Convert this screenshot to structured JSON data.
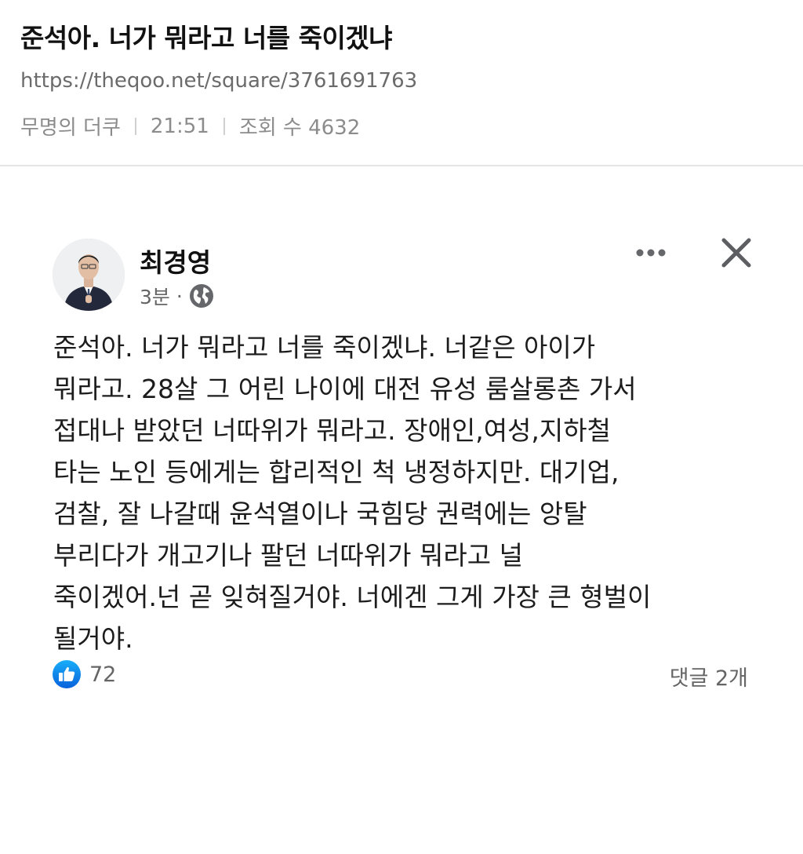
{
  "header": {
    "title": "준석아. 너가 뭐라고 너를 죽이겠냐",
    "url": "https://theqoo.net/square/3761691763",
    "author": "무명의 더쿠",
    "time": "21:51",
    "views": "조회 수 4632"
  },
  "post": {
    "author_name": "최경영",
    "time_ago": "3분",
    "dot": "·",
    "lines": [
      "준석아. 너가 뭐라고 너를 죽이겠냐. 너같은 아이가",
      "뭐라고. 28살 그 어린 나이에 대전 유성 룸살롱촌 가서",
      "접대나 받았던 너따위가 뭐라고. 장애인,여성,지하철",
      "타는 노인 등에게는 합리적인 척 냉정하지만. 대기업,",
      "검찰, 잘 나갈때 윤석열이나 국힘당 권력에는 앙탈",
      "부리다가 개고기나 팔던 너따위가 뭐라고 널",
      "죽이겠어.넌 곧 잊혀질거야. 너에겐 그게 가장 큰 형벌이",
      "될거야."
    ],
    "like_count": "72",
    "comment_count": "댓글 2개"
  },
  "icons": {
    "more": "more-options-icon",
    "close": "close-icon",
    "privacy": "globe-icon",
    "like": "like-thumbs-up-icon",
    "avatar": "profile-photo"
  },
  "colors": {
    "like_blue": "#1877f2",
    "muted_text": "#656565",
    "divider": "#e6e6e6"
  }
}
